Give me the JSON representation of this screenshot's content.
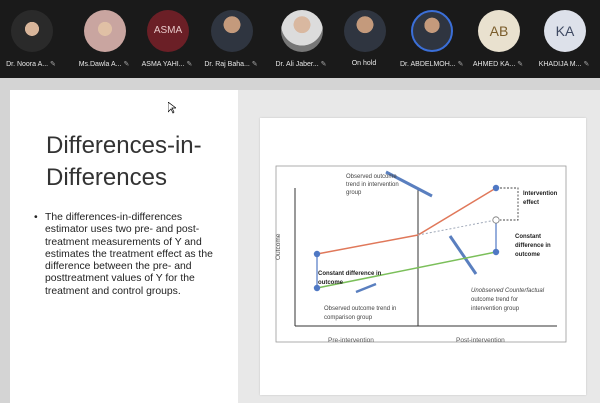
{
  "participants": [
    {
      "name": "Dr. Noora A...",
      "avatar": "photo",
      "muted": true
    },
    {
      "name": "Ms.Dawla A...",
      "avatar": "photo",
      "muted": true
    },
    {
      "name": "ASMA YAHI...",
      "avatar": "text",
      "avatar_text": "ASMA",
      "muted": true
    },
    {
      "name": "Dr. Raj Baha...",
      "avatar": "photo",
      "muted": true
    },
    {
      "name": "Dr. Ali Jaber...",
      "avatar": "photo",
      "muted": true
    },
    {
      "name": "On hold",
      "avatar": "photo",
      "muted": false
    },
    {
      "name": "Dr. ABDELMOH...",
      "avatar": "photo",
      "muted": true,
      "active_speaker": true
    },
    {
      "name": "AHMED KA...",
      "avatar": "initials",
      "avatar_text": "AB",
      "muted": true
    },
    {
      "name": "KHADIJA M...",
      "avatar": "initials",
      "avatar_text": "KA",
      "muted": true
    }
  ],
  "slide": {
    "title_line1": "Differences-in-",
    "title_line2": "Differences",
    "bullet": "The differences-in-differences estimator uses two pre- and post-treatment measurements of Y and estimates the treatment effect as the difference between the pre- and posttreatment values of Y for the treatment and control groups."
  },
  "figure": {
    "y_axis_label": "Outcome",
    "x_label_pre": "Pre-intervention",
    "x_label_post": "Post-intervention",
    "annotations": {
      "observed_intervention": [
        "Observed outcome",
        "trend in intervention",
        "group"
      ],
      "intervention_effect": [
        "Intervention",
        "effect"
      ],
      "constant_right": [
        "Constant",
        "difference in",
        "outcome"
      ],
      "constant_left": [
        "Constant difference in",
        "outcome"
      ],
      "observed_comparison": [
        "Observed outcome trend in",
        "comparison group"
      ],
      "counterfactual": [
        "Unobserved Counterfactual",
        "outcome trend for",
        "intervention group"
      ]
    },
    "colors": {
      "intervention": "#e0785a",
      "comparison": "#7bbf5a",
      "point": "#4f78c4",
      "counterfactual": "#9fa8b8"
    }
  },
  "icons": {
    "muted": "mic-off-icon",
    "cursor": "cursor-icon"
  }
}
